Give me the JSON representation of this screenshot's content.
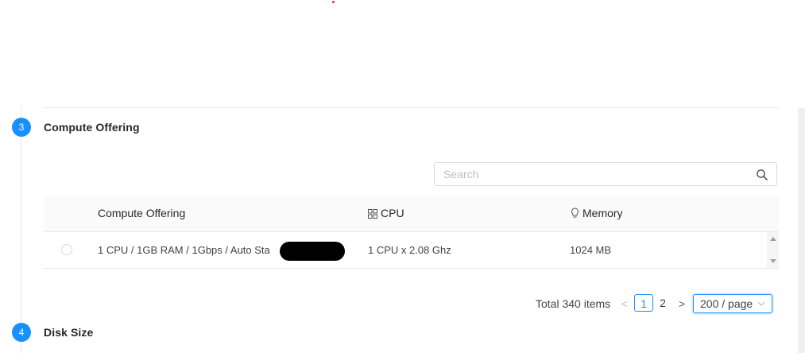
{
  "steps": [
    {
      "number": "3",
      "title": "Compute Offering"
    },
    {
      "number": "4",
      "title": "Disk Size"
    }
  ],
  "search": {
    "placeholder": "Search"
  },
  "table": {
    "columns": [
      "Compute Offering",
      "CPU",
      "Memory"
    ],
    "rows": [
      {
        "offering": "1 CPU / 1GB RAM / 1Gbps / Auto Sta",
        "cpu": "1 CPU x 2.08 Ghz",
        "memory": "1024 MB"
      }
    ]
  },
  "pagination": {
    "total": "Total 340 items",
    "prev": "<",
    "pages": [
      "1",
      "2"
    ],
    "next": ">",
    "page_size": "200 / page"
  },
  "colors": {
    "accent": "#1890ff"
  },
  "icons": {
    "search": "search-icon",
    "cpu": "grid-icon",
    "memory": "bulb-icon",
    "dropdown": "chevron-down-icon"
  }
}
